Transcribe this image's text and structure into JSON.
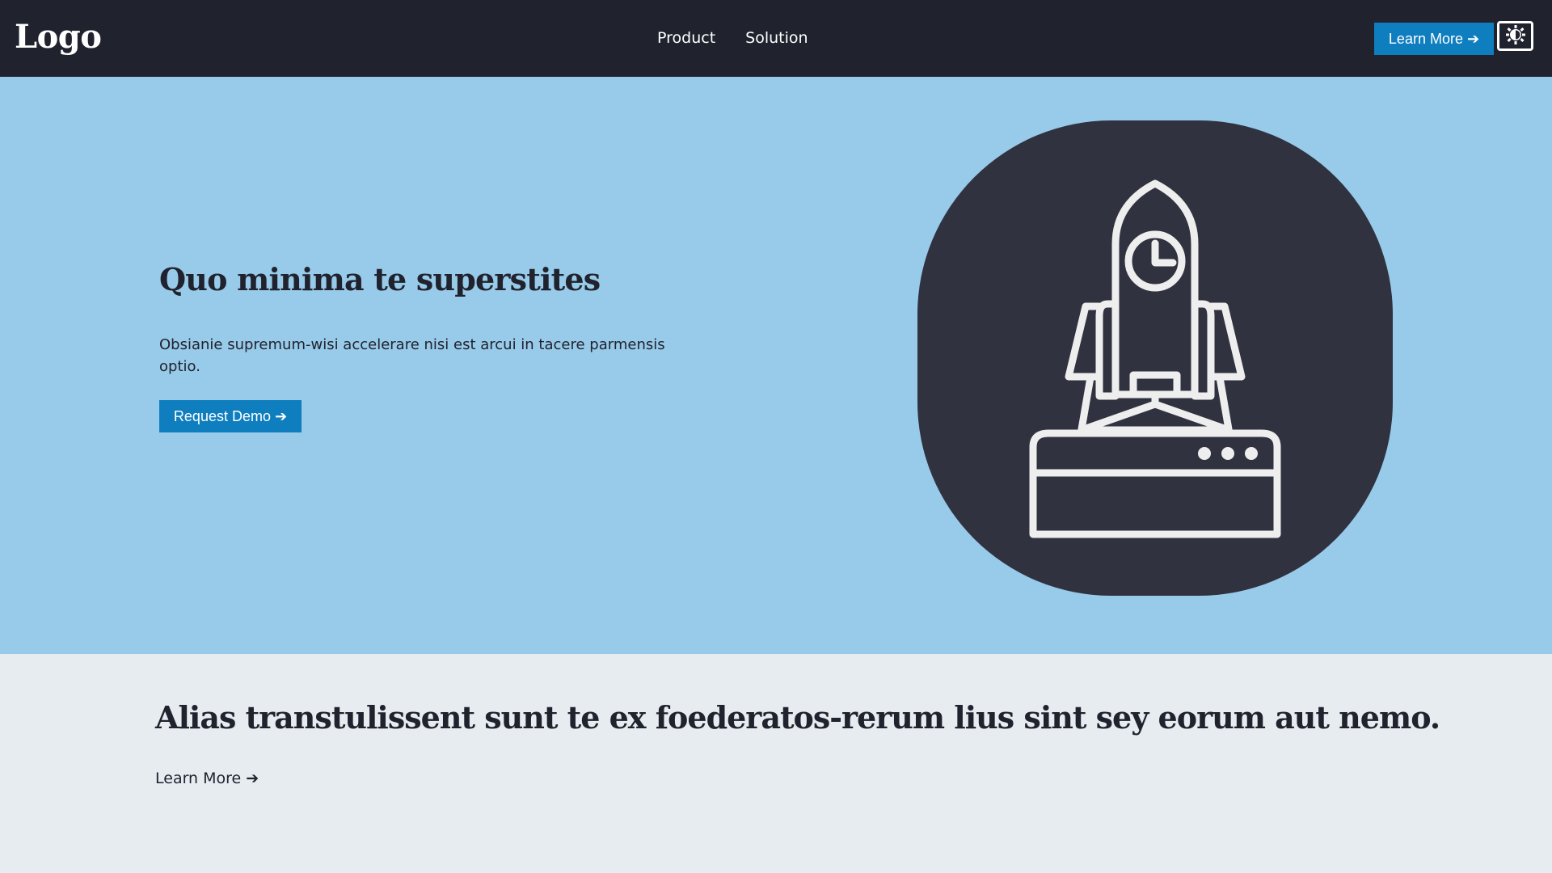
{
  "navbar": {
    "logo": "Logo",
    "links": [
      "Product",
      "Solution"
    ],
    "cta_label": "Learn More ➔",
    "theme_toggle_icon": "contrast-icon"
  },
  "hero": {
    "title": "Quo minima te superstites",
    "text": "Obsianie supremum-wisi accelerare nisi est arcui in tacere parmensis optio.",
    "button_label": "Request Demo ➔",
    "illustration_icon": "rocket-launch-icon"
  },
  "section": {
    "title": "Alias transtulissent sunt te ex foederatos-rerum lius sint sey eorum aut nemo.",
    "link_label": "Learn More ➔"
  },
  "colors": {
    "navbar_bg": "#20232e",
    "accent": "#0f7ebf",
    "hero_bg": "#98cae9",
    "illustration_bg": "#30323f",
    "section_bg": "#e6ecf0"
  }
}
